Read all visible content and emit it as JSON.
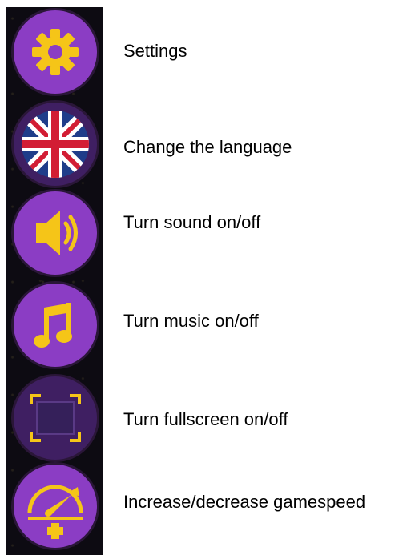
{
  "menu": {
    "items": [
      {
        "icon": "gear-icon",
        "label": "Settings"
      },
      {
        "icon": "uk-flag-icon",
        "label": "Change the language"
      },
      {
        "icon": "speaker-icon",
        "label": "Turn sound on/off"
      },
      {
        "icon": "music-note-icon",
        "label": "Turn music on/off"
      },
      {
        "icon": "fullscreen-icon",
        "label": "Turn fullscreen on/off"
      },
      {
        "icon": "speedometer-plus-icon",
        "label": "Increase/decrease gamespeed"
      }
    ]
  },
  "colors": {
    "icon_bg": "#8b3dc4",
    "icon_bg_dark": "#3f1f62",
    "icon_fg": "#f5c518",
    "strip_bg": "#0d0b12"
  }
}
